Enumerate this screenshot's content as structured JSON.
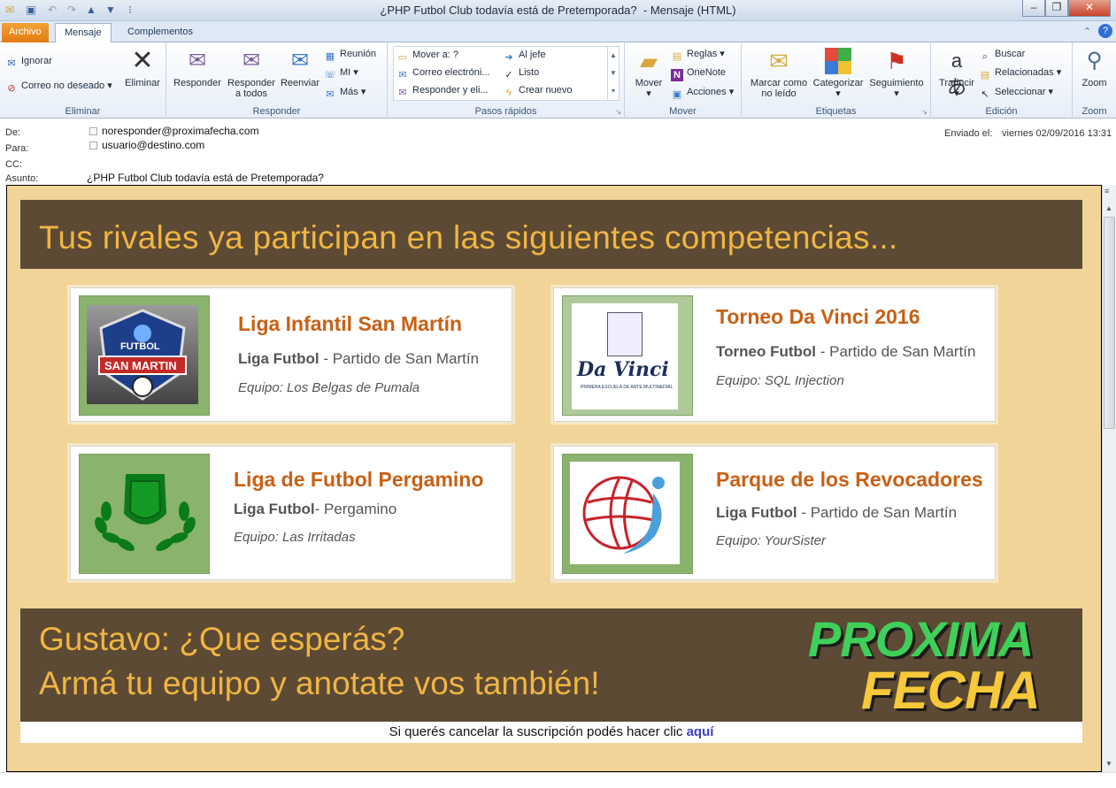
{
  "window": {
    "title": "¿PHP Futbol Club todavía está de Pretemporada?",
    "subtitle": "- Mensaje (HTML)"
  },
  "tabs": [
    {
      "label": "Archivo"
    },
    {
      "label": "Mensaje"
    },
    {
      "label": "Complementos"
    }
  ],
  "ribbon": {
    "eliminar": {
      "ignorar": "Ignorar",
      "correo_no_deseado": "Correo no deseado",
      "eliminar": "Eliminar",
      "label": "Eliminar"
    },
    "responder": {
      "responder": "Responder",
      "responder_todos_1": "Responder",
      "responder_todos_2": "a todos",
      "reenviar": "Reenviar",
      "reunion": "Reunión",
      "mi": "MI",
      "mas": "Más",
      "label": "Responder"
    },
    "pasos": {
      "mover_a": "Mover a: ?",
      "correo_electronico": "Correo electróni...",
      "responder_eli": "Responder y eli...",
      "al_jefe": "Al jefe",
      "listo": "Listo",
      "crear_nuevo": "Crear nuevo",
      "label": "Pasos rápidos"
    },
    "mover": {
      "mover": "Mover",
      "reglas": "Reglas",
      "onenote": "OneNote",
      "acciones": "Acciones",
      "label": "Mover"
    },
    "etiquetas": {
      "marcar_1": "Marcar como",
      "marcar_2": "no leído",
      "categorizar": "Categorizar",
      "seguimiento": "Seguimiento",
      "label": "Etiquetas"
    },
    "edicion": {
      "traducir": "Traducir",
      "buscar": "Buscar",
      "relacionadas": "Relacionadas",
      "seleccionar": "Seleccionar",
      "label": "Edición"
    },
    "zoom": {
      "zoom": "Zoom",
      "label": "Zoom"
    }
  },
  "headers": {
    "de_label": "De:",
    "de_value": "noresponder@proximafecha.com",
    "para_label": "Para:",
    "para_value": "usuario@destino.com",
    "cc_label": "CC:",
    "asunto_label": "Asunto:",
    "asunto_value": "¿PHP Futbol Club todavía está de Pretemporada?",
    "enviado_label": "Enviado el:",
    "enviado_value": "viernes 02/09/2016 13:31"
  },
  "email": {
    "banner_title": "Tus rivales ya participan en las siguientes competencias...",
    "cards": [
      {
        "title": "Liga Infantil San Martín",
        "sport": "Liga Futbol",
        "place": " - Partido de San Martín",
        "team": "Equipo: Los Belgas de Pumala",
        "logo_text_1": "FUTBOL",
        "logo_text_2": "SAN MARTIN"
      },
      {
        "title": "Torneo Da Vinci 2016",
        "sport": "Torneo Futbol",
        "place": " - Partido de San Martín",
        "team": "Equipo: SQL Injection",
        "logo_text_1": "Da Vinci",
        "logo_text_2": "PRIMERA ESCUELA DE ARTE MULTIMEDIAL"
      },
      {
        "title": "Liga de Futbol Pergamino",
        "sport": "Liga Futbol",
        "place": "- Pergamino",
        "team": "Equipo: Las Irritadas"
      },
      {
        "title": "Parque de los Revocadores",
        "sport": "Liga Futbol",
        "place": " - Partido de San Martín",
        "team": "Equipo: YourSister"
      }
    ],
    "cta_line1": "Gustavo: ¿Que esperás?",
    "cta_line2": "Armá tu equipo y anotate vos también!",
    "brand_1": "PROXIMA",
    "brand_2": "FECHA",
    "unsub_text": "Si querés cancelar la suscripción podés hacer clic ",
    "unsub_link": "aquí"
  },
  "colors": {
    "banner_bg": "#5c4a34",
    "banner_text": "#f0b543",
    "body_bg": "#f1d497",
    "card_title": "#c86014",
    "logo_green": "#8ab36e",
    "brand_green": "#3fd05a",
    "brand_yellow": "#f6c83a"
  }
}
